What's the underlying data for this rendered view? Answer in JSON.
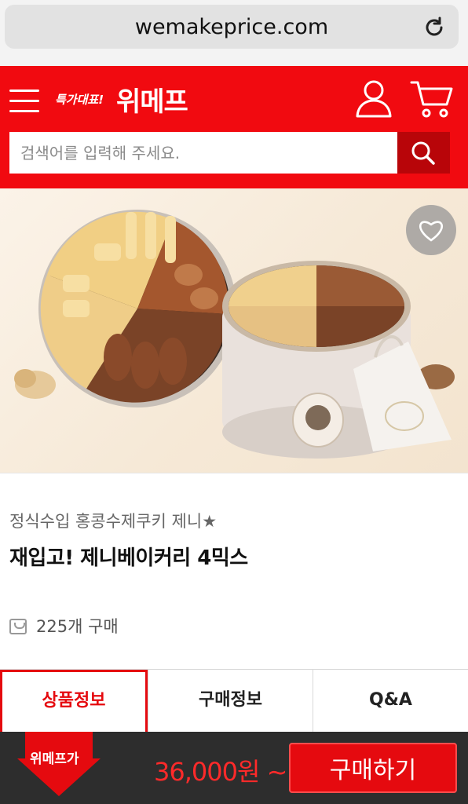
{
  "browser": {
    "url": "wemakeprice.com",
    "reload_icon": "reload-icon"
  },
  "header": {
    "logo_tagline": "특가대표!",
    "logo_name": "위메프",
    "menu_icon": "hamburger-menu-icon",
    "user_icon": "user-icon",
    "cart_icon": "cart-icon",
    "brand_color": "#f10a10"
  },
  "search": {
    "placeholder": "검색어를 입력해 주세요.",
    "button_icon": "search-icon"
  },
  "product": {
    "image_alt": "쿠키 틴 상자 두 개",
    "favorite_icon": "heart-icon",
    "subtitle": "정식수입 홍콩수제쿠키 제니★",
    "title": "재입고! 제니베이커리 4믹스",
    "purchase_count": "225개 구매"
  },
  "tabs": [
    {
      "label": "상품정보",
      "active": true
    },
    {
      "label": "구매정보",
      "active": false
    },
    {
      "label": "Q&A",
      "active": false
    }
  ],
  "bottom_bar": {
    "badge_label": "위메프가",
    "price": "36,000원 ~",
    "buy_label": "구매하기",
    "accent_color": "#e50a0f"
  }
}
